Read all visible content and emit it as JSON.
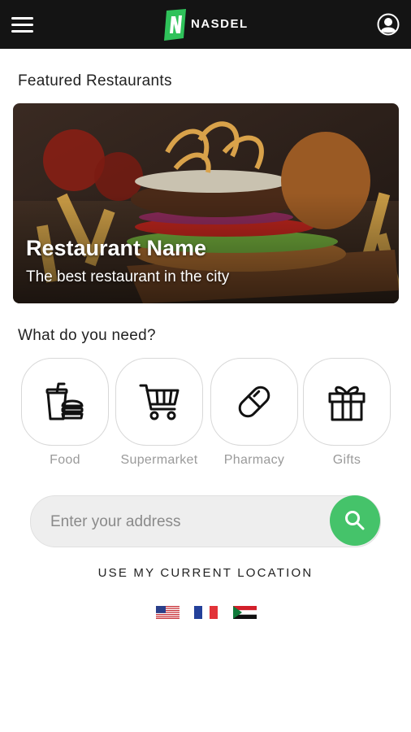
{
  "header": {
    "app_name": "NASDEL",
    "icons": {
      "menu": "hamburger-menu-icon",
      "logo": "nasdel-logo-icon",
      "profile": "user-profile-icon"
    }
  },
  "featured": {
    "section_title": "Featured Restaurants",
    "restaurant": {
      "name": "Restaurant Name",
      "tagline": "The best restaurant in the city"
    }
  },
  "categories": {
    "section_title": "What do you need?",
    "items": [
      {
        "label": "Food",
        "icon": "food-icon"
      },
      {
        "label": "Supermarket",
        "icon": "shopping-cart-icon"
      },
      {
        "label": "Pharmacy",
        "icon": "pill-icon"
      },
      {
        "label": "Gifts",
        "icon": "gift-icon"
      }
    ]
  },
  "address": {
    "placeholder": "Enter your address",
    "value": "",
    "search_icon": "search-icon"
  },
  "location_link": "USE MY CURRENT LOCATION",
  "languages": [
    {
      "code": "en",
      "icon": "us-flag-icon"
    },
    {
      "code": "fr",
      "icon": "france-flag-icon"
    },
    {
      "code": "ar",
      "icon": "sudan-flag-icon"
    }
  ],
  "colors": {
    "topbar": "#141414",
    "accent_green": "#45c36a",
    "category_label": "#9a9a9a"
  }
}
